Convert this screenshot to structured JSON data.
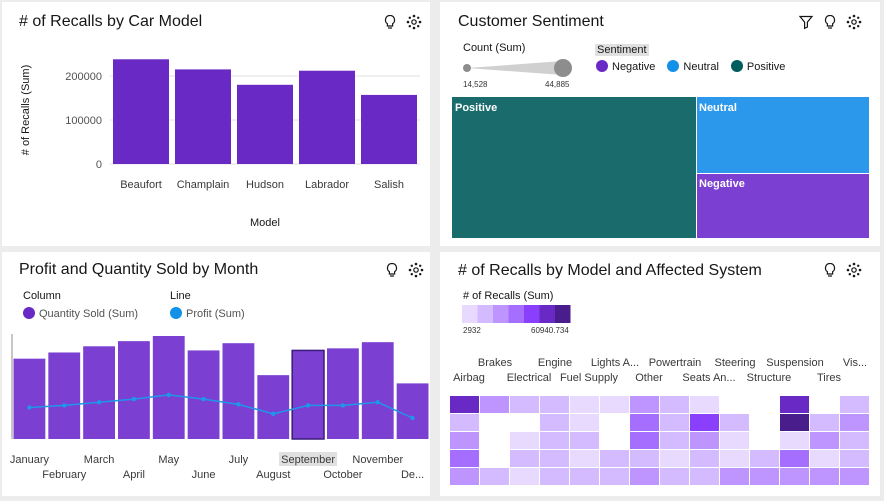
{
  "panel1": {
    "title": "# of Recalls by Car Model",
    "chart_data": {
      "type": "bar",
      "categories": [
        "Beaufort",
        "Champlain",
        "Hudson",
        "Labrador",
        "Salish"
      ],
      "values": [
        238000,
        215000,
        180000,
        212000,
        157000
      ],
      "xlabel": "Model",
      "ylabel": "# of Recalls (Sum)",
      "yticks": [
        "0",
        "100000",
        "200000"
      ],
      "ylim": [
        0,
        250000
      ],
      "color": "#6929c4"
    }
  },
  "panel2": {
    "title": "Customer Sentiment",
    "slider": {
      "label": "Count (Sum)",
      "min": "14,528",
      "max": "44,885"
    },
    "legend_title": "Sentiment",
    "legend": [
      {
        "name": "Negative",
        "color": "#6929c4"
      },
      {
        "name": "Neutral",
        "color": "#1192e8"
      },
      {
        "name": "Positive",
        "color": "#005d5d"
      }
    ],
    "treemap": {
      "positive": "Positive",
      "neutral": "Neutral",
      "negative": "Negative"
    },
    "colors": {
      "positive": "#1a6c6c",
      "neutral": "#2b98eb",
      "negative": "#7b3fd1"
    }
  },
  "panel3": {
    "title": "Profit and Quantity Sold by Month",
    "legend_column_title": "Column",
    "legend_column": "Quantity Sold (Sum)",
    "legend_line_title": "Line",
    "legend_line": "Profit (Sum)",
    "chart_data": {
      "type": "bar",
      "categories": [
        "January",
        "February",
        "March",
        "April",
        "May",
        "June",
        "July",
        "August",
        "September",
        "October",
        "November",
        "De..."
      ],
      "series": [
        {
          "name": "Quantity Sold (Sum)",
          "type": "bar",
          "values": [
            0.78,
            0.84,
            0.9,
            0.95,
            1.0,
            0.86,
            0.93,
            0.62,
            0.86,
            0.88,
            0.94,
            0.54
          ],
          "color": "#7b3fd1"
        },
        {
          "name": "Profit (Sum)",
          "type": "line",
          "values": [
            0.3,
            0.32,
            0.35,
            0.38,
            0.42,
            0.38,
            0.33,
            0.24,
            0.32,
            0.32,
            0.35,
            0.2
          ],
          "color": "#1f97e9"
        }
      ],
      "highlight": "September"
    }
  },
  "panel4": {
    "title": "# of Recalls by Model and Affected System",
    "legend_title": "# of Recalls (Sum)",
    "legend_min": "2932",
    "legend_max": "60940.734",
    "columns_top": [
      "Brakes",
      "Engine",
      "Lights A...",
      "Powertrain",
      "Steering",
      "Suspension",
      "Vis..."
    ],
    "columns_bottom": [
      "Airbag",
      "Electrical",
      "Fuel Supply",
      "Other",
      "Seats An...",
      "Structure",
      "Tires"
    ],
    "chart_data": {
      "type": "heatmap",
      "rows": 5,
      "cols": 14,
      "values": [
        [
          6,
          3,
          2,
          2,
          1,
          1,
          3,
          2,
          1,
          0,
          0,
          6,
          0,
          2
        ],
        [
          2,
          0,
          0,
          2,
          1,
          0,
          4,
          2,
          5,
          2,
          0,
          7,
          2,
          3
        ],
        [
          3,
          0,
          1,
          2,
          2,
          0,
          4,
          2,
          3,
          1,
          0,
          1,
          3,
          2
        ],
        [
          4,
          0,
          2,
          2,
          1,
          2,
          2,
          1,
          2,
          1,
          2,
          4,
          1,
          2
        ],
        [
          3,
          2,
          1,
          2,
          2,
          2,
          3,
          2,
          2,
          3,
          3,
          3,
          3,
          3
        ]
      ],
      "palette": [
        "#ffffff",
        "#e8daff",
        "#d4bbff",
        "#be95ff",
        "#a56eff",
        "#8a3ffc",
        "#6929c4",
        "#491d8b"
      ]
    }
  }
}
